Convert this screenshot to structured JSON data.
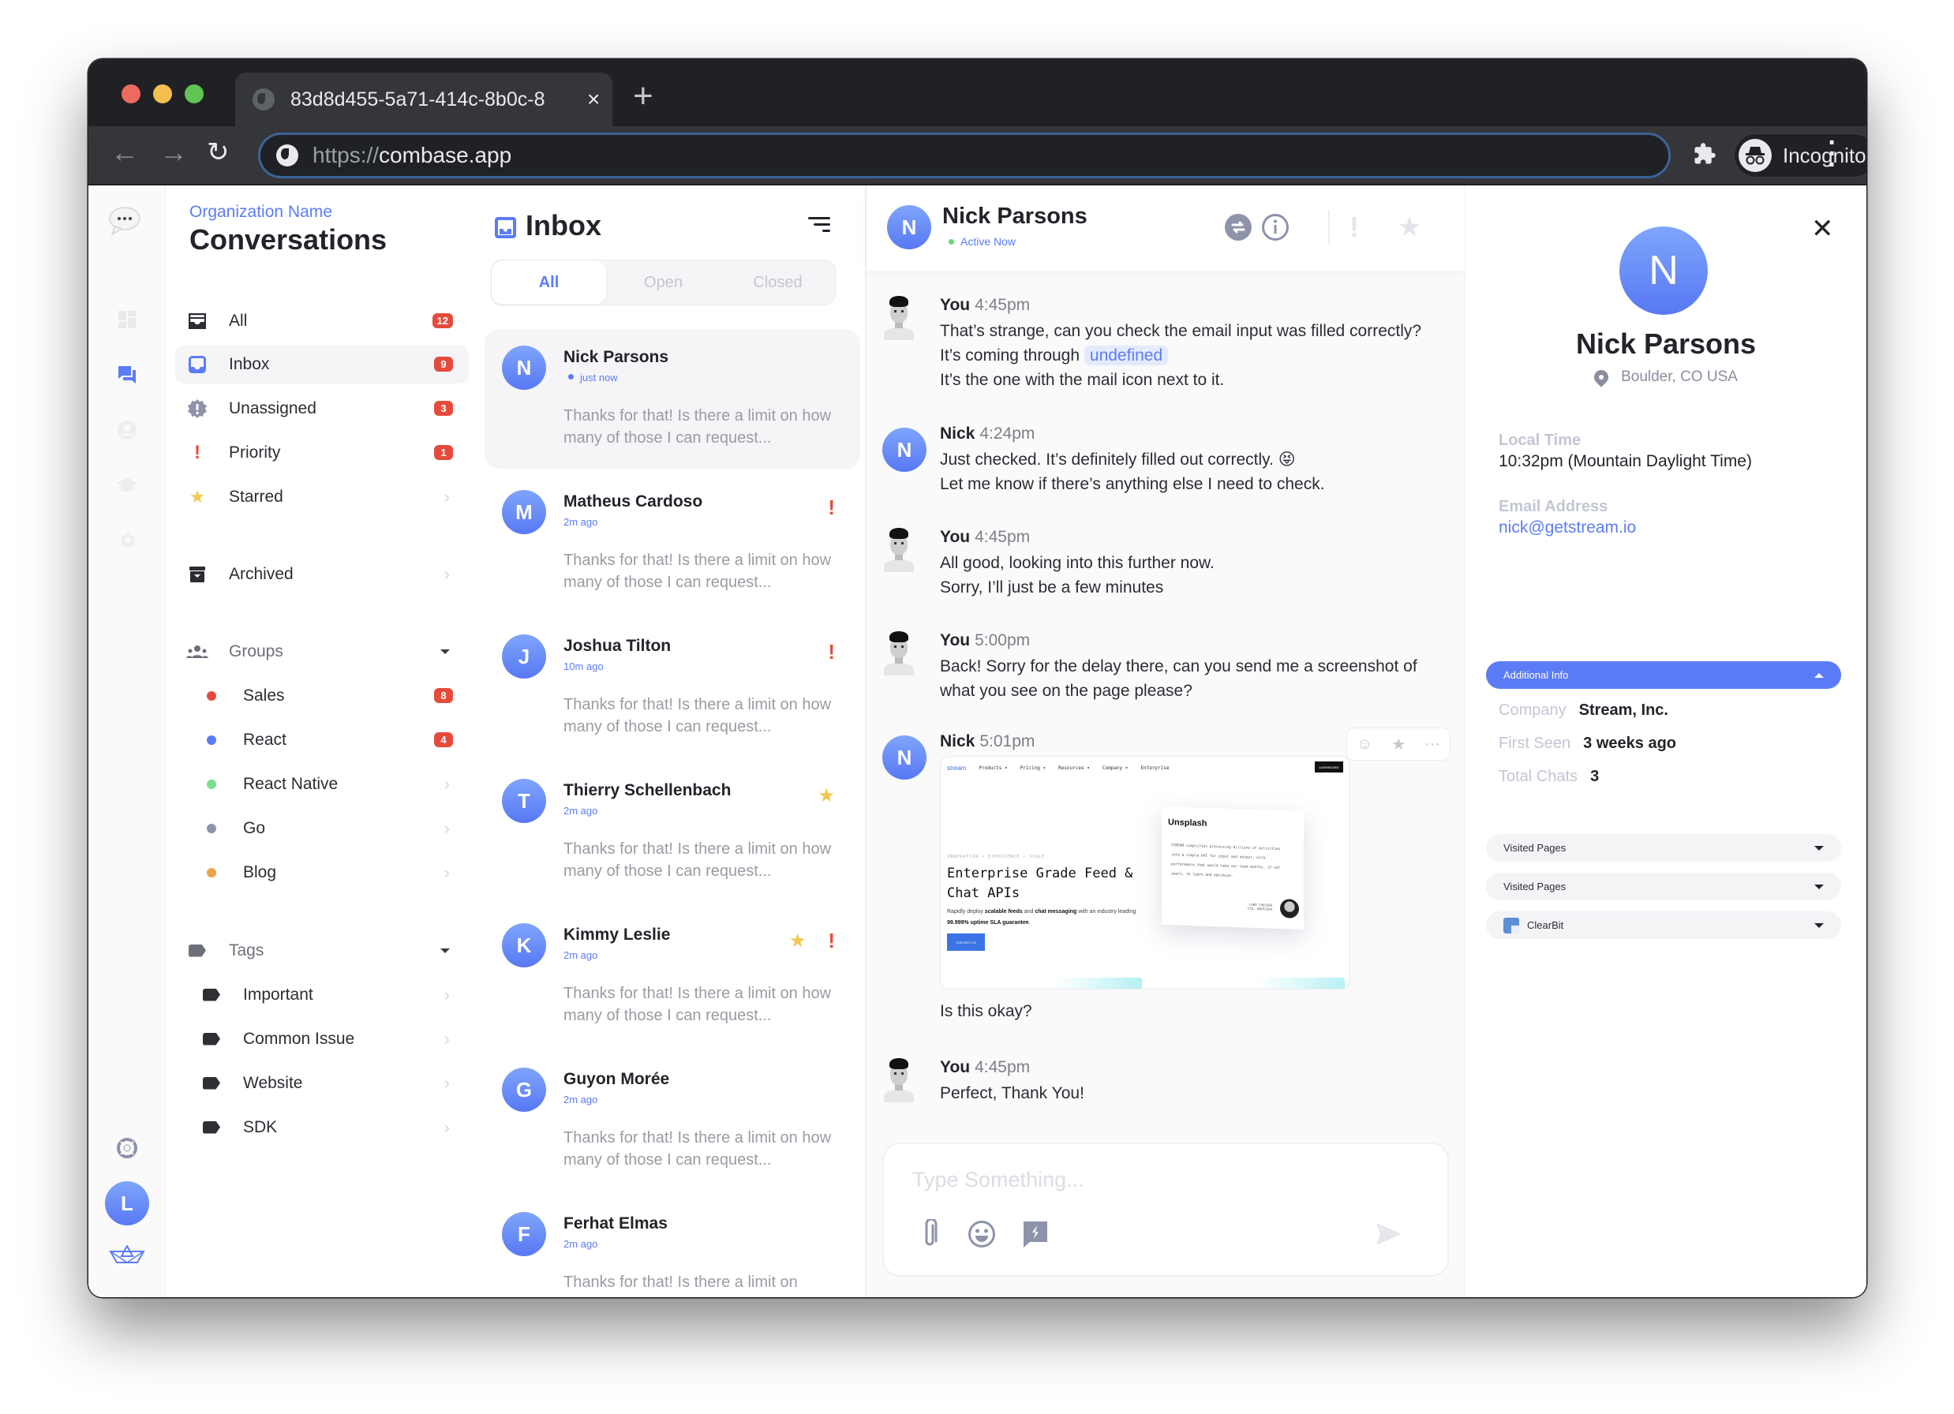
{
  "browser": {
    "tab_title": "83d8d455-5a71-414c-8b0c-8",
    "tab_close": "×",
    "new_tab": "+",
    "url_scheme": "https://",
    "url_host": "combase.app",
    "incognito_label": "Incognito",
    "back": "←",
    "forward": "→",
    "reload": "↻"
  },
  "rail": {
    "items": [
      "logo",
      "dashboard",
      "conversations",
      "contacts",
      "knowledge-base",
      "settings"
    ],
    "active": "conversations",
    "bottom": [
      "help",
      "user-avatar",
      "stream-logo"
    ],
    "user_initial": "L"
  },
  "nav": {
    "org_name": "Organization Name",
    "title": "Conversations",
    "items": [
      {
        "label": "All",
        "badge": "12"
      },
      {
        "label": "Inbox",
        "badge": "9"
      },
      {
        "label": "Unassigned",
        "badge": "3"
      },
      {
        "label": "Priority",
        "badge": "1"
      },
      {
        "label": "Starred",
        "badge": null
      }
    ],
    "archived": {
      "label": "Archived"
    },
    "groups": {
      "label": "Groups",
      "items": [
        {
          "label": "Sales",
          "badge": "8",
          "color": "#e54b3c"
        },
        {
          "label": "React",
          "badge": "4",
          "color": "#5b7cf6"
        },
        {
          "label": "React Native",
          "badge": null,
          "color": "#7be08a"
        },
        {
          "label": "Go",
          "badge": null,
          "color": "#8e93ab"
        },
        {
          "label": "Blog",
          "badge": null,
          "color": "#f0a24a"
        }
      ]
    },
    "tags": {
      "label": "Tags",
      "items": [
        {
          "label": "Important"
        },
        {
          "label": "Common Issue"
        },
        {
          "label": "Website"
        },
        {
          "label": "SDK"
        }
      ]
    }
  },
  "inbox": {
    "title": "Inbox",
    "filters": [
      "All",
      "Open",
      "Closed"
    ],
    "active_filter": "All",
    "conversations": [
      {
        "initial": "N",
        "name": "Nick Parsons",
        "time": "just now",
        "preview": "Thanks for that! Is there a limit on how many of those I can request...",
        "starred": false,
        "priority": false,
        "active": true
      },
      {
        "initial": "M",
        "name": "Matheus Cardoso",
        "time": "2m ago",
        "preview": "Thanks for that! Is there a limit on how many of those I can request...",
        "starred": false,
        "priority": true
      },
      {
        "initial": "J",
        "name": "Joshua Tilton",
        "time": "10m ago",
        "preview": "Thanks for that! Is there a limit on how many of those I can request...",
        "starred": false,
        "priority": true
      },
      {
        "initial": "T",
        "name": "Thierry Schellenbach",
        "time": "2m ago",
        "preview": "Thanks for that! Is there a limit on how many of those I can request...",
        "starred": true,
        "priority": false
      },
      {
        "initial": "K",
        "name": "Kimmy Leslie",
        "time": "2m ago",
        "preview": "Thanks for that! Is there a limit on how many of those I can request...",
        "starred": true,
        "priority": true
      },
      {
        "initial": "G",
        "name": "Guyon Morée",
        "time": "2m ago",
        "preview": "Thanks for that! Is there a limit on how many of those I can request...",
        "starred": false,
        "priority": false
      },
      {
        "initial": "F",
        "name": "Ferhat Elmas",
        "time": "2m ago",
        "preview": "Thanks for that! Is there a limit on",
        "starred": false,
        "priority": false
      }
    ]
  },
  "chat": {
    "contact_initial": "N",
    "contact_name": "Nick Parsons",
    "status": "Active Now",
    "messages": [
      {
        "author": "You",
        "time": "4:45pm",
        "lines": [
          "That’s strange, can you check the email input was filled correctly?",
          "It’s coming through",
          "It’s the one with the mail icon next to it."
        ],
        "chip": "undefined"
      },
      {
        "author": "Nick",
        "time": "4:24pm",
        "lines": [
          "Just checked. It’s definitely filled out correctly. 😝",
          "Let me know if there’s anything else I need to check."
        ]
      },
      {
        "author": "You",
        "time": "4:45pm",
        "lines": [
          "All good, looking into this further now.",
          "Sorry, I’ll just be a few minutes"
        ]
      },
      {
        "author": "You",
        "time": "5:00pm",
        "lines": [
          "Back! Sorry for the delay there, can you send me a screenshot of",
          "what you see on the page please?"
        ]
      },
      {
        "author": "Nick",
        "time": "5:01pm",
        "lines": [
          "Is this okay?"
        ],
        "attachment": {
          "nav": [
            "Products ▾",
            "Pricing ▾",
            "Resources ▾",
            "Company ▾",
            "Enterprise"
          ],
          "logo": "stream",
          "dashboard": "DASHBOARD",
          "kicker": "INNOVATION • EXPERIENCE • SCALE",
          "headline": "Enterprise Grade Feed & Chat APIs",
          "sub_pre": "Rapidly deploy ",
          "sub_b1": "scalable feeds",
          "sub_mid": " and ",
          "sub_b2": "chat messaging",
          "sub_mid2": " with an industry leading ",
          "sub_b3": "99.999% uptime SLA guarantee",
          "sub_end": ".",
          "cta": "CONTACT US",
          "card_title": "Unsplash",
          "card_body": "STREAM simplifies processing billions of activities into a simple API for input and output, with performance that would take our team months, if not years, to learn and optimize.",
          "card_sig": "LUKE CHESSER",
          "card_role": "CTO, UNSPLASH"
        }
      },
      {
        "author": "You",
        "time": "4:45pm",
        "lines": [
          "Perfect, Thank You!"
        ]
      }
    ],
    "composer_placeholder": "Type Something..."
  },
  "profile": {
    "initial": "N",
    "name": "Nick Parsons",
    "location": "Boulder, CO USA",
    "local_time_label": "Local Time",
    "local_time": "10:32pm (Mountain Daylight Time)",
    "email_label": "Email Address",
    "email": "nick@getstream.io",
    "additional_info_label": "Additional Info",
    "additional": [
      {
        "key": "Company",
        "value": "Stream, Inc."
      },
      {
        "key": "First Seen",
        "value": "3 weeks ago"
      },
      {
        "key": "Total Chats",
        "value": "3"
      }
    ],
    "sections": [
      "Visited Pages",
      "Visited Pages",
      "ClearBit"
    ]
  },
  "colors": {
    "accent": "#5b7cf6",
    "badge": "#e54b3c",
    "star": "#f1c84b"
  }
}
